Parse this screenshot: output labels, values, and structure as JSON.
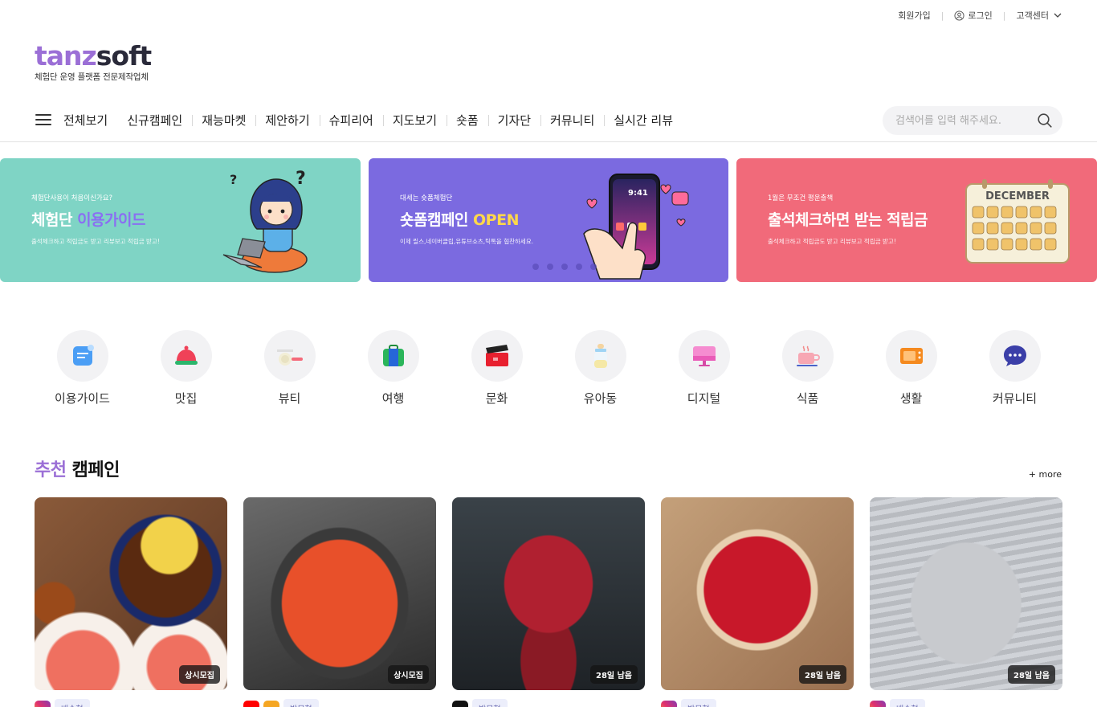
{
  "util": {
    "signup": "회원가입",
    "login": "로그인",
    "support": "고객센터"
  },
  "logo": {
    "word_a": "tanz",
    "word_b": "soft",
    "tagline": "체험단 운영 플랫폼 전문제작업체"
  },
  "nav": [
    "전체보기",
    "신규캠페인",
    "재능마켓",
    "제안하기",
    "슈피리어",
    "지도보기",
    "숏폼",
    "기자단",
    "커뮤니티",
    "실시간 리뷰"
  ],
  "search": {
    "placeholder": "검색어를 입력 해주세요."
  },
  "banners": [
    {
      "small": "체험단사용이 처음이신가요?",
      "big_a": "체험단 ",
      "big_b": "이용가이드",
      "desc": "출석체크하고 적립금도 받고 리뷰보고 적립금 받고!"
    },
    {
      "small": "대세는 숏폼체험단",
      "big_a": "숏폼캠페인 ",
      "big_b": "OPEN",
      "desc": "이제 릴스,네이버클립,유튜브쇼츠,틱톡을 협찬하세요."
    },
    {
      "small": "1월은 무조건 평운출책",
      "big_a": "출석체크하면 받는 적립금",
      "big_b": "",
      "desc": "출석체크하고 적립금도 받고 리뷰보고 적립금 받고!",
      "calendar_title": "DECEMBER"
    }
  ],
  "phone_time": "9:41",
  "categories": [
    "이용가이드",
    "맛집",
    "뷰티",
    "여행",
    "문화",
    "유아동",
    "디지털",
    "식품",
    "생활",
    "커뮤니티"
  ],
  "recommend": {
    "title_accent": "추천",
    "title_rest": " 캠페인",
    "more": "+ more"
  },
  "cards": [
    {
      "badge": "상시모집",
      "chip": "배송형"
    },
    {
      "badge": "상시모집",
      "chip": "방문형"
    },
    {
      "badge": "28일 남음",
      "chip": "방문형"
    },
    {
      "badge": "28일 남음",
      "chip": "방문형"
    },
    {
      "badge": "28일 남음",
      "chip": "배송형"
    }
  ],
  "colors": {
    "accent": "#9b6fd6",
    "banner1": "#7fd4c5",
    "banner2": "#7b6ae0",
    "banner3": "#f16a7a"
  }
}
